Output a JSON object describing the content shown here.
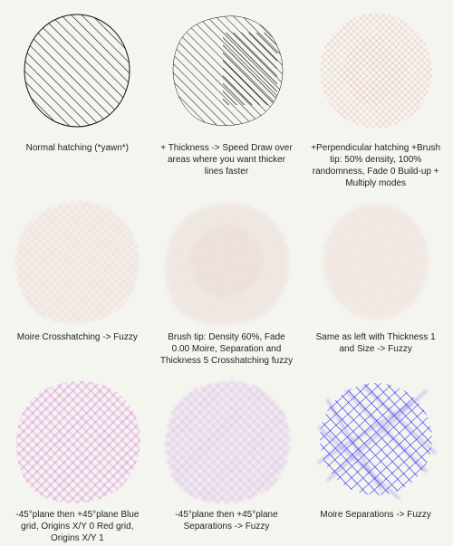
{
  "cells": [
    {
      "id": 1,
      "caption": "Normal hatching\n(*yawn*)",
      "type": "normal_hatch",
      "color": "#111111",
      "color2": null
    },
    {
      "id": 2,
      "caption": "+ Thickness -> Speed\nDraw over areas where you\nwant thicker lines faster",
      "type": "thick_hatch",
      "color": "#111111",
      "color2": null
    },
    {
      "id": 3,
      "caption": "+Perpendicular hatching\n+Brush tip: 50% density,\n100% randomness, Fade 0\nBuild-up + Multiply modes",
      "type": "cross_hatch_red",
      "color": "#cc4444",
      "color2": null
    },
    {
      "id": 4,
      "caption": "Moire\nCrosshatching -> Fuzzy",
      "type": "moire_red",
      "color": "#c05555",
      "color2": null
    },
    {
      "id": 5,
      "caption": "Brush tip: Density 60%, Fade 0.00\nMoire, Separation and Thickness 5\nCrosshatching fuzzy",
      "type": "moire_dense",
      "color": "#aa4444",
      "color2": null
    },
    {
      "id": 6,
      "caption": "Same as left with\nThickness 1 and\nSize -> Fuzzy",
      "type": "moire_fuzzy",
      "color": "#aa4444",
      "color2": null
    },
    {
      "id": 7,
      "caption": "-45°plane then +45°plane\nBlue grid, Origins X/Y 0\nRed grid, Origins X/Y 1",
      "type": "purple_grid",
      "color": "#cc44cc",
      "color2": "#cc44cc"
    },
    {
      "id": 8,
      "caption": "-45°plane then +45°plane\nSeparations -> Fuzzy",
      "type": "purple_fuzzy",
      "color": "#9955cc",
      "color2": null
    },
    {
      "id": 9,
      "caption": "Moire\nSeparations -> Fuzzy",
      "type": "blue_moire",
      "color": "#3333dd",
      "color2": null
    }
  ]
}
